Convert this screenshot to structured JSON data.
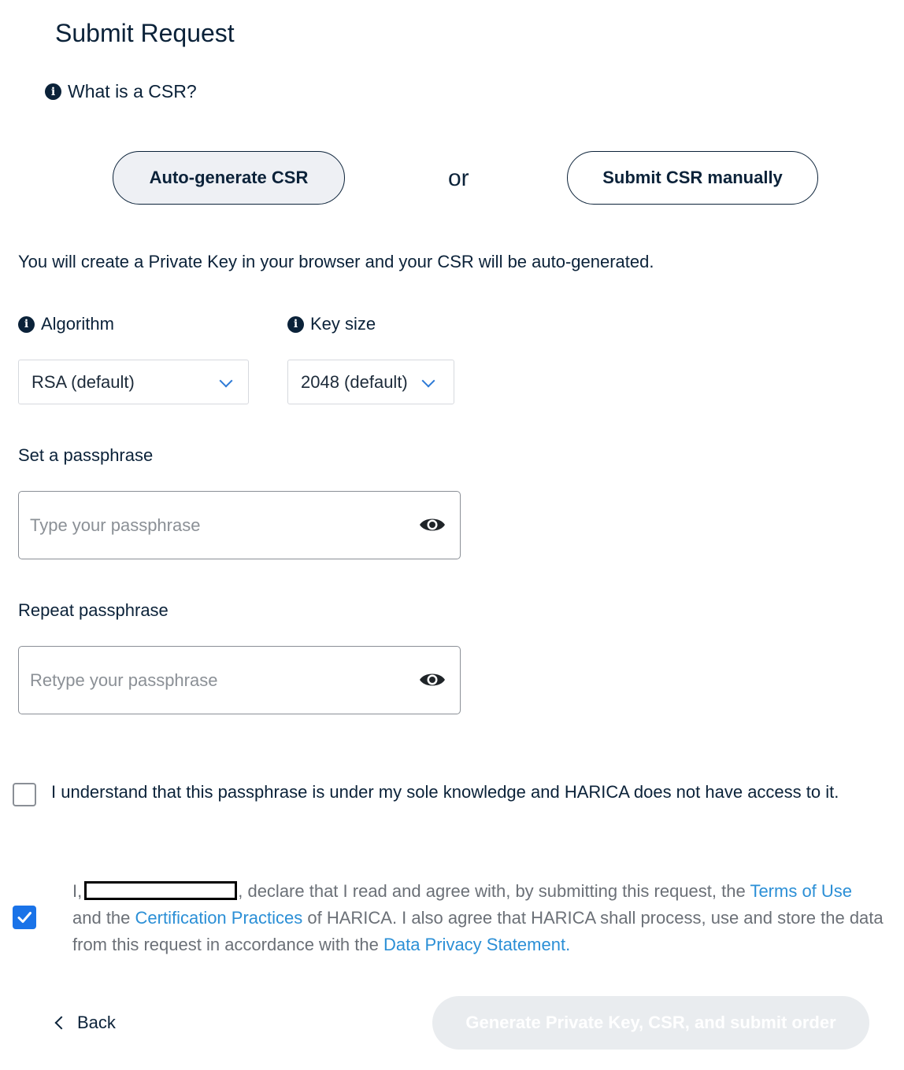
{
  "page": {
    "title": "Submit Request"
  },
  "csr_help": {
    "label": "What is a CSR?",
    "icon": "info-icon"
  },
  "mode": {
    "auto_label": "Auto-generate CSR",
    "or_label": "or",
    "manual_label": "Submit CSR manually",
    "selected": "auto"
  },
  "description": "You will create a Private Key in your browser and your CSR will be auto-generated.",
  "algorithm": {
    "label": "Algorithm",
    "value": "RSA (default)",
    "icon": "info-icon"
  },
  "key_size": {
    "label": "Key size",
    "value": "2048 (default)",
    "icon": "info-icon"
  },
  "passphrase": {
    "label": "Set a passphrase",
    "placeholder": "Type your passphrase",
    "value": ""
  },
  "repeat_passphrase": {
    "label": "Repeat passphrase",
    "placeholder": "Retype your passphrase",
    "value": ""
  },
  "understand": {
    "checked": false,
    "text": "I understand that this passphrase is under my sole knowledge and HARICA does not have access to it."
  },
  "declaration": {
    "checked": true,
    "prefix": "I,",
    "part1": ", declare that I read and agree with, by submitting this request, the ",
    "terms_link": "Terms of Use",
    "part2": " and the ",
    "practices_link": "Certification Practices",
    "part3": " of HARICA. I also agree that HARICA shall process, use and store the data from this request in accordance with the ",
    "privacy_link": "Data Privacy Statement."
  },
  "actions": {
    "back_label": "Back",
    "submit_label": "Generate Private Key, CSR, and submit order",
    "submit_disabled": true
  },
  "colors": {
    "navy": "#0b2239",
    "link": "#2b8fd6",
    "checkbox": "#1a73e8",
    "disabled_bg": "#e9ecef"
  }
}
